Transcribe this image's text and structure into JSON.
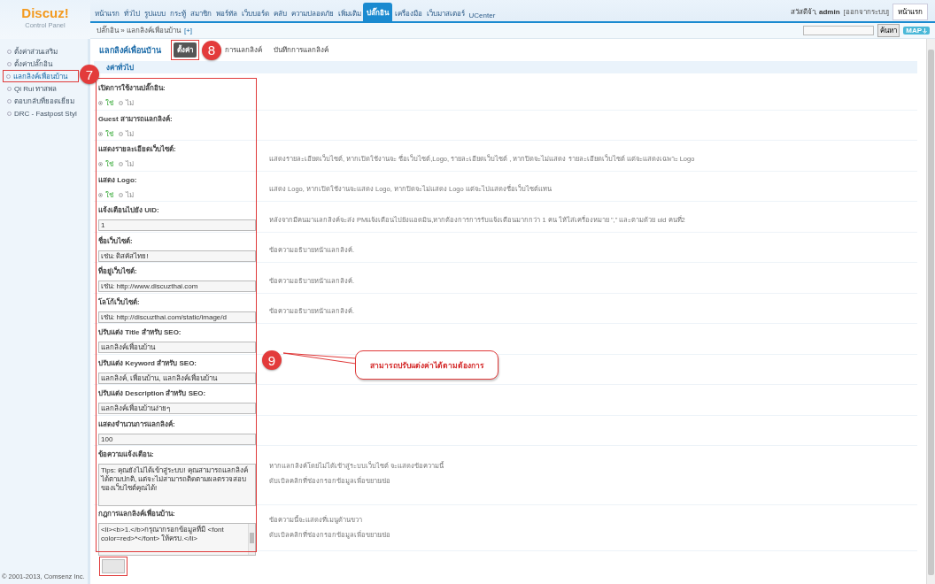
{
  "logo": {
    "title": "Discuz!",
    "subtitle": "Control Panel"
  },
  "nav": [
    {
      "label": "หน้าแรก",
      "selected": false
    },
    {
      "label": "ทั่วไป",
      "selected": false
    },
    {
      "label": "รูปแบบ",
      "selected": false
    },
    {
      "label": "กระทู้",
      "selected": false
    },
    {
      "label": "สมาชิก",
      "selected": false
    },
    {
      "label": "พอร์ทัล",
      "selected": false
    },
    {
      "label": "เว็บบอร์ด",
      "selected": false
    },
    {
      "label": "คลับ",
      "selected": false
    },
    {
      "label": "ความปลอดภัย",
      "selected": false
    },
    {
      "label": "เพิ่มเติม",
      "selected": false
    },
    {
      "label": "ปลั๊กอิน",
      "selected": true
    },
    {
      "label": "เครื่องมือ",
      "selected": false
    },
    {
      "label": "เว็บมาสเตอร์",
      "selected": false
    },
    {
      "label": "UCenter",
      "selected": false
    }
  ],
  "user": {
    "greeting": "สวัสดีจ้า, **admin**",
    "logout": "[ออกจากระบบ]",
    "home_button": "หน้าแรก"
  },
  "breadcrumb": {
    "text": "ปลั๊กอิน » แลกลิงค์เพื่อนบ้าน",
    "add": "[+]"
  },
  "search": {
    "button": "ค้นหา",
    "map_button": "MAP"
  },
  "sidebar": {
    "items": [
      {
        "label": "ตั้งค่าส่วนเสริม",
        "selected": false,
        "highlighted": false
      },
      {
        "label": "ตั้งค่าปลั๊กอิน",
        "selected": false,
        "highlighted": false
      },
      {
        "label": "แลกลิงค์เพื่อนบ้าน",
        "selected": true,
        "highlighted": true,
        "annotation": "7"
      },
      {
        "label": "Qi Rui ทาสพล",
        "selected": false,
        "highlighted": false
      },
      {
        "label": "ตอบกลับที่ยอดเยี่ยม",
        "selected": false,
        "highlighted": false
      },
      {
        "label": "DRC - Fastpost Styl",
        "selected": false,
        "highlighted": false
      }
    ],
    "footer": "© 2001-2013, Comsenz Inc."
  },
  "page": {
    "title": "แลกลิงค์เพื่อนบ้าน",
    "tabs": [
      {
        "label": "ตั้งค่า",
        "selected": true,
        "highlighted": true,
        "annotation": "8"
      },
      {
        "label": "การแลกลิงค์",
        "selected": false,
        "highlighted": false
      },
      {
        "label": "บันทึกการแลกลิงค์",
        "selected": false,
        "highlighted": false
      }
    ],
    "section": "งค่าทั่วไป",
    "settings_highlighted": true,
    "settings": [
      {
        "kind": "radio",
        "label": "เปิดการใช้งานปลั๊กอิน:",
        "options": [
          {
            "label": "ใช่",
            "selected": true
          },
          {
            "label": "ไม่",
            "selected": false
          }
        ]
      },
      {
        "kind": "radio",
        "label": "Guest สามารถแลกลิงค์:",
        "options": [
          {
            "label": "ใช่",
            "selected": true
          },
          {
            "label": "ไม่",
            "selected": false
          }
        ]
      },
      {
        "kind": "radio",
        "label": "แสดงรายละเอียดเว็บไซต์:",
        "options": [
          {
            "label": "ใช่",
            "selected": true
          },
          {
            "label": "ไม่",
            "selected": false
          }
        ],
        "description": [
          "แสดงรายละเอียดเว็บไซต์, หากเปิดใช้งานจะ ชื่อเว็บไซต์,Logo, รายละเอียดเว็บไซต์ , หากปิดจะไม่แสดง รายละเอียดเว็บไซต์ แต่จะแสดงเฉพาะ Logo"
        ]
      },
      {
        "kind": "radio",
        "label": "แสดง Logo:",
        "options": [
          {
            "label": "ใช่",
            "selected": true
          },
          {
            "label": "ไม่",
            "selected": false
          }
        ],
        "description": [
          "แสดง Logo, หากเปิดใช้งานจะแสดง Logo, หากปิดจะไม่แสดง Logo แต่จะไปแสดงชื่อเว็บไซต์แทน"
        ]
      },
      {
        "kind": "input",
        "label": "แจ้งเตือนไปยัง UID:",
        "value": "1",
        "description": [
          "หลังจากมีคนมาแลกลิงค์จะส่ง PMแจ้งเตือนไปยังแอดมิน,หากต้องการการรับแจ้งเตือนมากกว่า 1 คน ให้ใส่เครื่องหมาย \",\" และตามด้วย uid คนที่2"
        ]
      },
      {
        "kind": "input",
        "label": "ชื่อเว็บไซต์:",
        "value": "เช่น: ดิสคัสไทย!",
        "description": [
          "ข้อความอธิบายหน้าแลกลิงค์."
        ]
      },
      {
        "kind": "input",
        "label": "ที่อยู่เว็บไซต์:",
        "value": "เช่น: http://www.discuzthai.com",
        "description": [
          "ข้อความอธิบายหน้าแลกลิงค์."
        ]
      },
      {
        "kind": "input",
        "label": "โลโก้เว็บไซต์:",
        "value": "เช่น: http://discuzthai.com/static/image/d",
        "description": [
          "ข้อความอธิบายหน้าแลกลิงค์."
        ]
      },
      {
        "kind": "input",
        "label": "ปรับแต่ง Title สำหรับ SEO:",
        "value": "แลกลิงค์เพื่อนบ้าน"
      },
      {
        "kind": "input",
        "label": "ปรับแต่ง Keyword สำหรับ SEO:",
        "value": "แลกลิงค์, เพื่อนบ้าน, แลกลิงค์เพื่อนบ้าน"
      },
      {
        "kind": "input",
        "label": "ปรับแต่ง Description สำหรับ SEO:",
        "value": "แลกลิงค์เพื่อนบ้านง่ายๆ"
      },
      {
        "kind": "input",
        "label": "แสดงจำนวนการแลกลิงค์:",
        "value": "100"
      },
      {
        "kind": "textarea",
        "label": "ข้อความแจ้งเตือน:",
        "value": "Tips: คุณยังไม่ได้เข้าสู่ระบบ! คุณสามารถแลกลิงค์ได้ตามปกติ, แต่จะไม่สามารถติดตามผลตรวจสอบของเว็บไซต์คุณได้!",
        "description": [
          "หากแลกลิงค์โดยไม่ได้เข้าสู่ระบบเว็บไซต์ จะแสดงข้อความนี้",
          "ดับเบิลคลิกที่ช่องกรอกข้อมูลเพื่อขยาย/ย่อ"
        ]
      },
      {
        "kind": "textarea",
        "label": "กฎการแลกลิงค์เพื่อนบ้าน:",
        "value": "<li><b>1.</b>กรุณากรอกข้อมูลที่มี <font color=red>*</font> ให้ครบ.</li>",
        "scroll": true,
        "description": [
          "ข้อความนี้จะแสดงที่เมนูด้านขวา",
          "ดับเบิลคลิกที่ช่องกรอกข้อมูลเพื่อขยาย/ย่อ"
        ]
      }
    ],
    "callout": {
      "number": "9",
      "text": "สามารถปรับแต่งค่าได้ตามต้องการ"
    },
    "submit": {
      "highlighted": true
    }
  }
}
